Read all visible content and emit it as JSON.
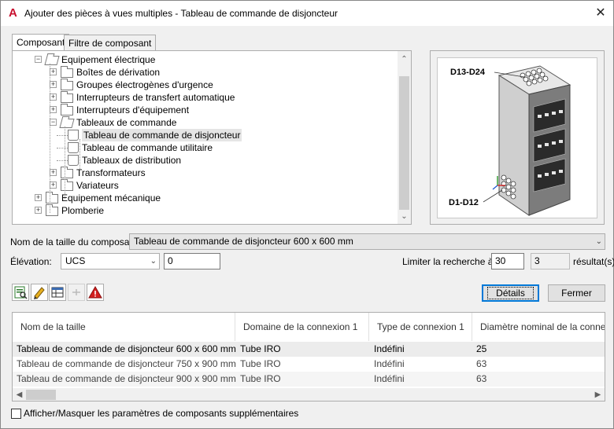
{
  "window": {
    "title": "Ajouter des pièces à vues multiples - Tableau de commande de disjoncteur",
    "app_icon": "A",
    "close_glyph": "✕"
  },
  "tabs": [
    {
      "label": "Composant",
      "active": true
    },
    {
      "label": "Filtre de composant",
      "active": false
    }
  ],
  "tree": {
    "items": [
      {
        "label": "Equipement électrique",
        "icon": "folder-open-icon",
        "expander": "⊟",
        "level": 1
      },
      {
        "label": "Boîtes de dérivation",
        "icon": "folder-icon",
        "expander": "⊞",
        "level": 2
      },
      {
        "label": "Groupes électrogènes d'urgence",
        "icon": "folder-icon",
        "expander": "⊞",
        "level": 2
      },
      {
        "label": "Interrupteurs de transfert automatique",
        "icon": "folder-icon",
        "expander": "⊞",
        "level": 2
      },
      {
        "label": "Interrupteurs d'équipement",
        "icon": "folder-icon",
        "expander": "⊞",
        "level": 2
      },
      {
        "label": "Tableaux de commande",
        "icon": "folder-open-icon",
        "expander": "⊟",
        "level": 2
      },
      {
        "label": "Tableau de commande de disjoncteur",
        "icon": "part-icon",
        "level": 3,
        "selected": true
      },
      {
        "label": "Tableau de commande utilitaire",
        "icon": "part-icon",
        "level": 3
      },
      {
        "label": "Tableaux de distribution",
        "icon": "part-icon",
        "level": 3
      },
      {
        "label": "Transformateurs",
        "icon": "folder-icon",
        "expander": "⊞",
        "level": 2
      },
      {
        "label": "Variateurs",
        "icon": "folder-icon",
        "expander": "⊞",
        "level": 2
      },
      {
        "label": "Equipement mécanique",
        "icon": "folder-icon",
        "expander": "⊞",
        "level": 1
      },
      {
        "label": "Plomberie",
        "icon": "folder-icon",
        "expander": "⊞",
        "level": 1
      }
    ],
    "scroll_up": "⌃",
    "scroll_down": "⌄"
  },
  "preview": {
    "label_top": "D13-D24",
    "label_bottom": "D1-D12"
  },
  "size": {
    "label": "Nom de la taille du composant:",
    "value": "Tableau de commande de disjoncteur 600 x 600 mm"
  },
  "elevation": {
    "label": "Élévation:",
    "mode": "UCS",
    "value": "0"
  },
  "limit": {
    "label": "Limiter la recherche à:",
    "value": "30",
    "results": "3",
    "results_label": "résultat(s)"
  },
  "toolbar": {
    "icons": [
      "catalog-search-icon",
      "edit-pencil-icon",
      "table-view-icon",
      "pin-icon",
      "warning-icon"
    ]
  },
  "buttons": {
    "details": "Détails",
    "close": "Fermer"
  },
  "grid": {
    "columns": [
      "Nom de la taille",
      "Domaine de la connexion 1",
      "Type de connexion 1",
      "Diamètre nominal de la conne"
    ],
    "rows": [
      [
        "Tableau de commande de disjoncteur 600 x 600 mm",
        "Tube IRO",
        "Indéfini",
        "25"
      ],
      [
        "Tableau de commande de disjoncteur 750 x 900 mm",
        "Tube IRO",
        "Indéfini",
        "63"
      ],
      [
        "Tableau de commande de disjoncteur 900 x 900 mm",
        "Tube IRO",
        "Indéfini",
        "63"
      ]
    ],
    "scroll_left": "◀",
    "scroll_right": "▶"
  },
  "footer": {
    "checkbox_label": "Afficher/Masquer les paramètres de composants supplémentaires",
    "checked": false
  }
}
